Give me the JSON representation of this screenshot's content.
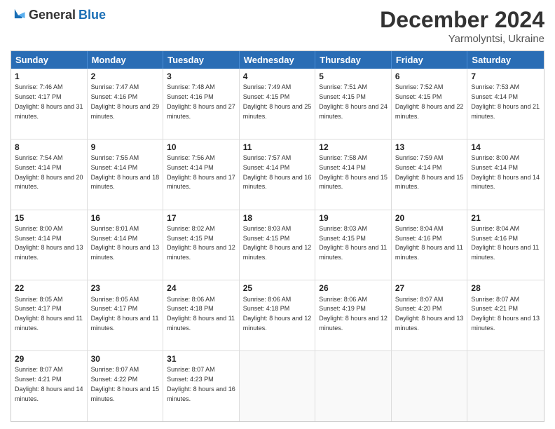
{
  "header": {
    "logo_general": "General",
    "logo_blue": "Blue",
    "month": "December 2024",
    "location": "Yarmolyntsi, Ukraine"
  },
  "days_of_week": [
    "Sunday",
    "Monday",
    "Tuesday",
    "Wednesday",
    "Thursday",
    "Friday",
    "Saturday"
  ],
  "weeks": [
    [
      {
        "day": "1",
        "rise": "7:46 AM",
        "set": "4:17 PM",
        "daylight": "8 hours and 31 minutes."
      },
      {
        "day": "2",
        "rise": "7:47 AM",
        "set": "4:16 PM",
        "daylight": "8 hours and 29 minutes."
      },
      {
        "day": "3",
        "rise": "7:48 AM",
        "set": "4:16 PM",
        "daylight": "8 hours and 27 minutes."
      },
      {
        "day": "4",
        "rise": "7:49 AM",
        "set": "4:15 PM",
        "daylight": "8 hours and 25 minutes."
      },
      {
        "day": "5",
        "rise": "7:51 AM",
        "set": "4:15 PM",
        "daylight": "8 hours and 24 minutes."
      },
      {
        "day": "6",
        "rise": "7:52 AM",
        "set": "4:15 PM",
        "daylight": "8 hours and 22 minutes."
      },
      {
        "day": "7",
        "rise": "7:53 AM",
        "set": "4:14 PM",
        "daylight": "8 hours and 21 minutes."
      }
    ],
    [
      {
        "day": "8",
        "rise": "7:54 AM",
        "set": "4:14 PM",
        "daylight": "8 hours and 20 minutes."
      },
      {
        "day": "9",
        "rise": "7:55 AM",
        "set": "4:14 PM",
        "daylight": "8 hours and 18 minutes."
      },
      {
        "day": "10",
        "rise": "7:56 AM",
        "set": "4:14 PM",
        "daylight": "8 hours and 17 minutes."
      },
      {
        "day": "11",
        "rise": "7:57 AM",
        "set": "4:14 PM",
        "daylight": "8 hours and 16 minutes."
      },
      {
        "day": "12",
        "rise": "7:58 AM",
        "set": "4:14 PM",
        "daylight": "8 hours and 15 minutes."
      },
      {
        "day": "13",
        "rise": "7:59 AM",
        "set": "4:14 PM",
        "daylight": "8 hours and 15 minutes."
      },
      {
        "day": "14",
        "rise": "8:00 AM",
        "set": "4:14 PM",
        "daylight": "8 hours and 14 minutes."
      }
    ],
    [
      {
        "day": "15",
        "rise": "8:00 AM",
        "set": "4:14 PM",
        "daylight": "8 hours and 13 minutes."
      },
      {
        "day": "16",
        "rise": "8:01 AM",
        "set": "4:14 PM",
        "daylight": "8 hours and 13 minutes."
      },
      {
        "day": "17",
        "rise": "8:02 AM",
        "set": "4:15 PM",
        "daylight": "8 hours and 12 minutes."
      },
      {
        "day": "18",
        "rise": "8:03 AM",
        "set": "4:15 PM",
        "daylight": "8 hours and 12 minutes."
      },
      {
        "day": "19",
        "rise": "8:03 AM",
        "set": "4:15 PM",
        "daylight": "8 hours and 11 minutes."
      },
      {
        "day": "20",
        "rise": "8:04 AM",
        "set": "4:16 PM",
        "daylight": "8 hours and 11 minutes."
      },
      {
        "day": "21",
        "rise": "8:04 AM",
        "set": "4:16 PM",
        "daylight": "8 hours and 11 minutes."
      }
    ],
    [
      {
        "day": "22",
        "rise": "8:05 AM",
        "set": "4:17 PM",
        "daylight": "8 hours and 11 minutes."
      },
      {
        "day": "23",
        "rise": "8:05 AM",
        "set": "4:17 PM",
        "daylight": "8 hours and 11 minutes."
      },
      {
        "day": "24",
        "rise": "8:06 AM",
        "set": "4:18 PM",
        "daylight": "8 hours and 11 minutes."
      },
      {
        "day": "25",
        "rise": "8:06 AM",
        "set": "4:18 PM",
        "daylight": "8 hours and 12 minutes."
      },
      {
        "day": "26",
        "rise": "8:06 AM",
        "set": "4:19 PM",
        "daylight": "8 hours and 12 minutes."
      },
      {
        "day": "27",
        "rise": "8:07 AM",
        "set": "4:20 PM",
        "daylight": "8 hours and 13 minutes."
      },
      {
        "day": "28",
        "rise": "8:07 AM",
        "set": "4:21 PM",
        "daylight": "8 hours and 13 minutes."
      }
    ],
    [
      {
        "day": "29",
        "rise": "8:07 AM",
        "set": "4:21 PM",
        "daylight": "8 hours and 14 minutes."
      },
      {
        "day": "30",
        "rise": "8:07 AM",
        "set": "4:22 PM",
        "daylight": "8 hours and 15 minutes."
      },
      {
        "day": "31",
        "rise": "8:07 AM",
        "set": "4:23 PM",
        "daylight": "8 hours and 16 minutes."
      },
      null,
      null,
      null,
      null
    ]
  ]
}
